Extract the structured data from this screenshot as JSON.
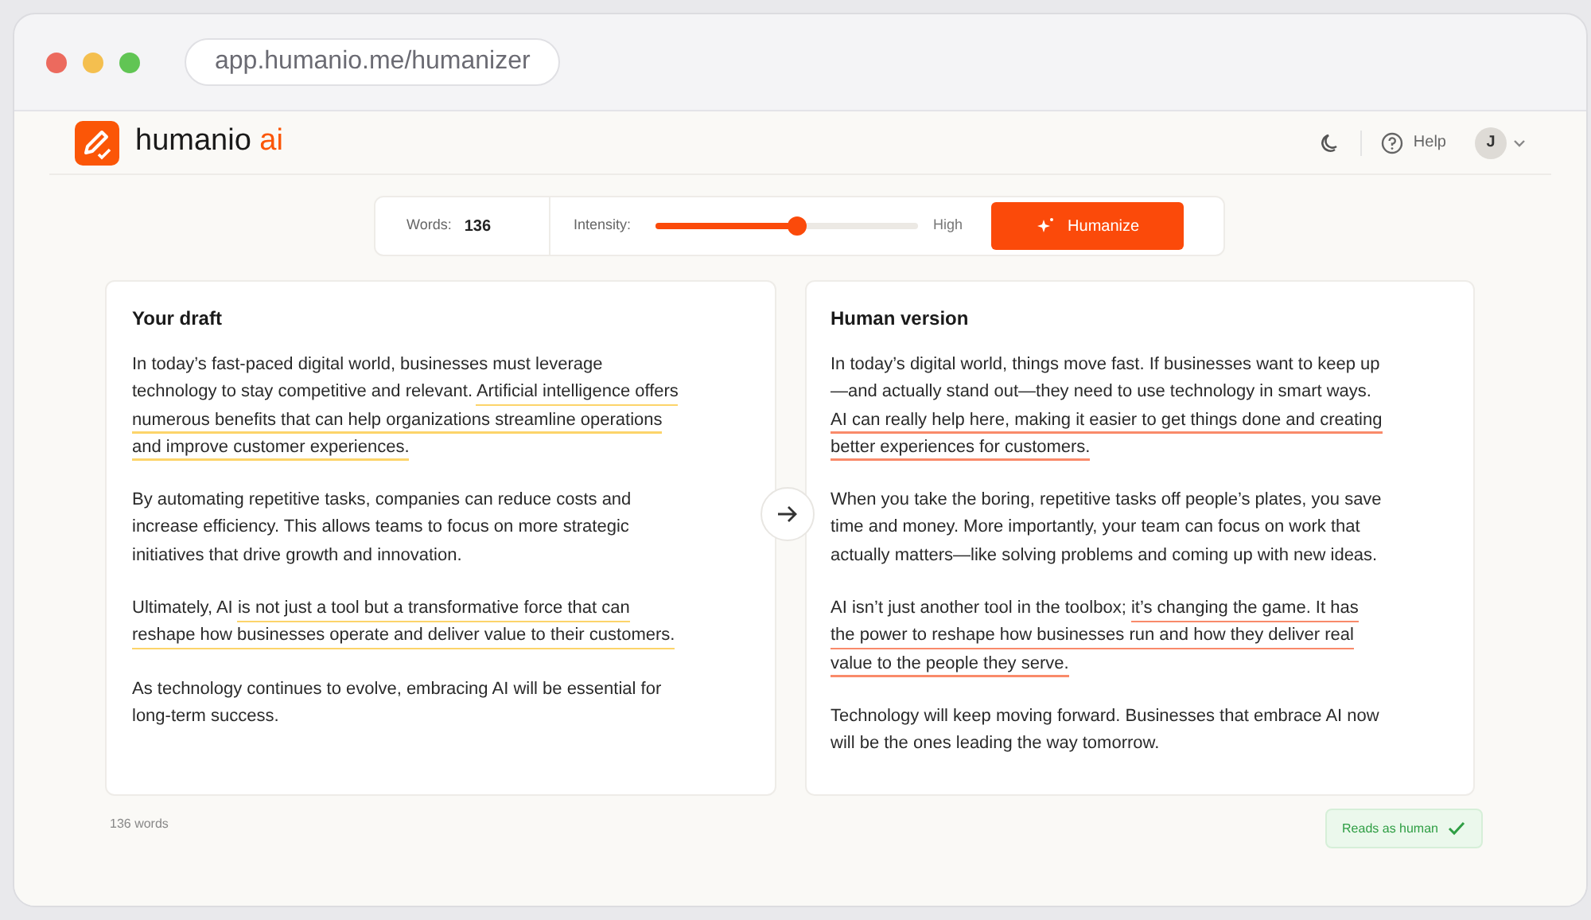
{
  "browser": {
    "address": "app.humanio.me/humanizer"
  },
  "header": {
    "brand": "humanio",
    "brand_accent": "ai",
    "help": "Help",
    "avatar": "J"
  },
  "toolbar": {
    "words_label": "Words:",
    "words_value": "136",
    "intensity_label": "Intensity:",
    "level": 0.54,
    "intensity_max": "High",
    "button": "Humanize"
  },
  "panels": [
    {
      "kind": "draft",
      "title": "Your draft",
      "paragraphs": [
        [
          {
            "text": "In today’s fast-paced digital world, businesses must leverage technology to stay competitive and relevant. ",
            "underlined": false
          },
          {
            "text": "Artificial intelligence offers numerous benefits that can help organizations streamline operations and improve customer experiences.",
            "underlined": true
          }
        ],
        [
          {
            "text": "By automating repetitive tasks, companies can reduce costs and increase efficiency. This allows teams to focus on more strategic initiatives that drive growth and innovation.",
            "underlined": false
          }
        ],
        [
          {
            "text": "Ultimately, AI ",
            "underlined": false
          },
          {
            "text": "is not just a tool but a transformative force that can reshape how businesses operate and deliver value to their customers.",
            "underlined": true
          }
        ],
        [
          {
            "text": "As technology continues to evolve, embracing AI will be essential for long-term success.",
            "underlined": false
          }
        ]
      ]
    },
    {
      "kind": "human",
      "title": "Human version",
      "paragraphs": [
        [
          {
            "text": "In today’s digital world, things move fast. If businesses want to keep up—and actually stand out—they need to use technology in smart ways. ",
            "underlined": false
          },
          {
            "text": "AI can really help here, making it easier to get things done and creating better experiences for customers.",
            "underlined": true
          }
        ],
        [
          {
            "text": "When you take the boring, repetitive tasks off people’s plates, you save time and money. More importantly, your team can focus on work that actually matters—like solving problems and coming up with new ideas.",
            "underlined": false
          }
        ],
        [
          {
            "text": "AI isn’t just another tool in the toolbox; ",
            "underlined": false
          },
          {
            "text": "it’s changing the game. It has the power to reshape how businesses run and how they deliver real value to the people they serve.",
            "underlined": true
          }
        ],
        [
          {
            "text": "Technology will keep moving forward. Businesses that embrace AI now will be the ones leading the way tomorrow.",
            "underlined": false
          }
        ]
      ]
    }
  ],
  "footer": {
    "word_count": "136 words",
    "badge": "Reads as human"
  }
}
